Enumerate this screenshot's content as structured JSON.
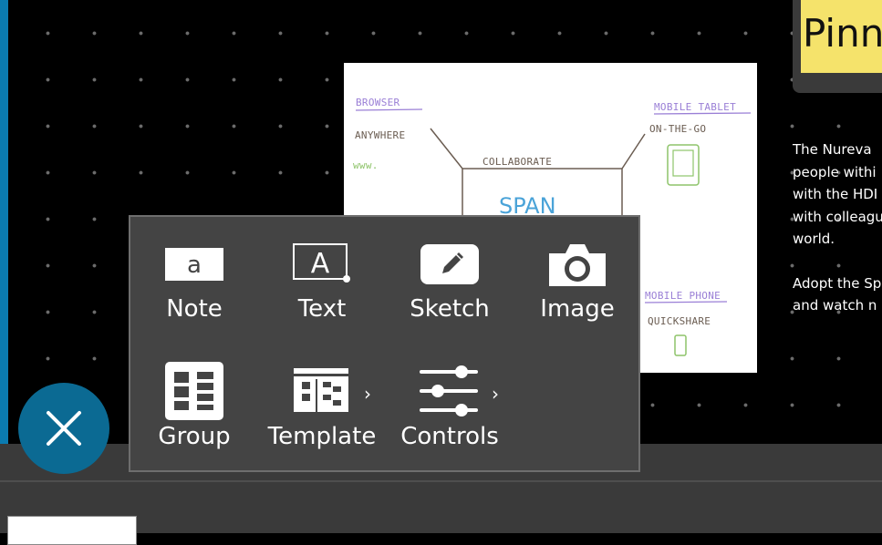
{
  "canvas": {
    "sketch": {
      "browser_label": "BROWSER",
      "anywhere_label": "ANYWHERE",
      "www_label": "www.",
      "collaborate_label": "COLLABORATE",
      "span_label": "SPAN",
      "mobile_tablet_label": "MOBILE TABLET",
      "on_the_go_label": "ON-THE-GO",
      "mobile_phone_label": "MOBILE PHONE",
      "quickshare_label": "QUICKSHARE"
    },
    "pinned_note": {
      "title": "Pinn"
    },
    "side_text": {
      "line1": "The Nureva",
      "line2": "people withi",
      "line3": "with the HDI",
      "line4": "with colleagu",
      "line5": "world.",
      "line6": "Adopt the Sp",
      "line7": "and watch n"
    }
  },
  "add_menu": {
    "items": [
      {
        "label": "Note",
        "icon": "note-icon"
      },
      {
        "label": "Text",
        "icon": "text-box-icon"
      },
      {
        "label": "Sketch",
        "icon": "pencil-icon"
      },
      {
        "label": "Image",
        "icon": "camera-icon"
      },
      {
        "label": "Group",
        "icon": "group-grid-icon"
      },
      {
        "label": "Template",
        "icon": "template-icon",
        "submenu": true
      },
      {
        "label": "Controls",
        "icon": "sliders-icon",
        "submenu": true
      }
    ],
    "note_glyph": "a",
    "text_glyph": "A",
    "chevron": "›"
  },
  "close_button": {
    "icon": "close-icon"
  },
  "colors": {
    "accent": "#0b7bb0",
    "menu_bg": "#444444",
    "note_yellow": "#f5e36b"
  }
}
